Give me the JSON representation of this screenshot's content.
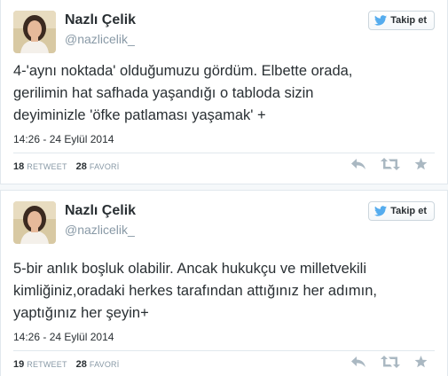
{
  "tweets": [
    {
      "name": "Nazlı Çelik",
      "handle": "@nazlicelik_",
      "follow_label": "Takip et",
      "text": "4-'aynı noktada' olduğumuzu gördüm. Elbette orada,\ngerilimin hat safhada yaşandığı o tabloda sizin\ndeyiminizle 'öfke patlaması yaşamak' +",
      "date": "14:26 - 24 Eylül 2014",
      "retweets": "18",
      "retweet_label": "RETWEET",
      "favorites": "28",
      "favorite_label": "FAVORİ"
    },
    {
      "name": "Nazlı Çelik",
      "handle": "@nazlicelik_",
      "follow_label": "Takip et",
      "text": "5-bir anlık boşluk olabilir. Ancak hukukçu ve milletvekili\nkimliğiniz,oradaki herkes tarafından attığınız her adımın,\nyaptığınız her şeyin+",
      "date": "14:26 - 24 Eylül 2014",
      "retweets": "19",
      "retweet_label": "RETWEET",
      "favorites": "28",
      "favorite_label": "FAVORİ"
    }
  ],
  "icons": {
    "follow": "twitter-bird-icon",
    "reply": "reply-icon",
    "retweet": "retweet-icon",
    "favorite": "star-icon"
  },
  "colors": {
    "text": "#292f33",
    "muted": "#8899a6",
    "brand": "#55acee",
    "icon": "#aab8c2"
  }
}
